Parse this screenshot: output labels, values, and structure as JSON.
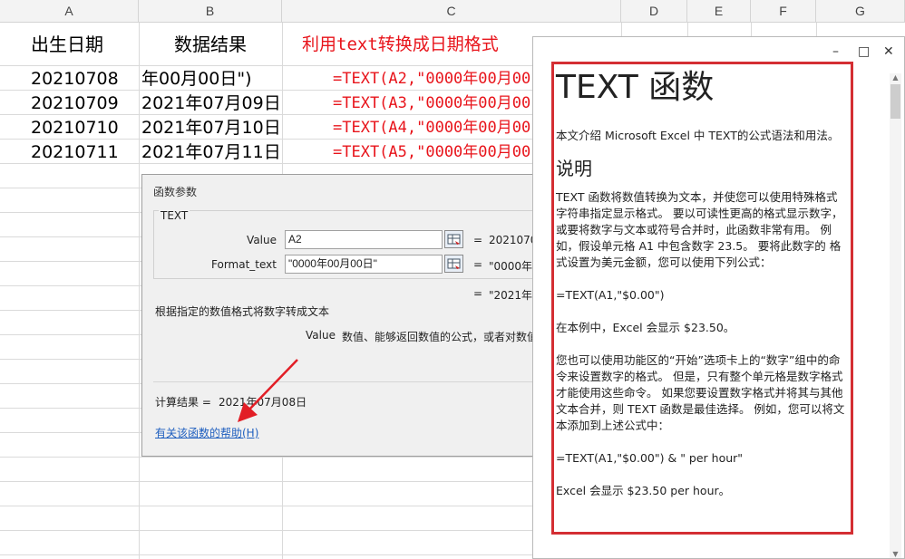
{
  "columns": [
    "A",
    "B",
    "C",
    "D",
    "E",
    "F",
    "G"
  ],
  "headers": {
    "a": "出生日期",
    "b": "数据结果",
    "c": "利用text转换成日期格式"
  },
  "rows": [
    {
      "a": "20210708",
      "b": "年00月00日\")",
      "c": "=TEXT(A2,\"0000年00月00"
    },
    {
      "a": "20210709",
      "b": "2021年07月09日",
      "c": "=TEXT(A3,\"0000年00月00"
    },
    {
      "a": "20210710",
      "b": "2021年07月10日",
      "c": "=TEXT(A4,\"0000年00月00"
    },
    {
      "a": "20210711",
      "b": "2021年07月11日",
      "c": "=TEXT(A5,\"0000年00月00"
    }
  ],
  "dialog": {
    "title": "函数参数",
    "func_name": "TEXT",
    "value_label": "Value",
    "value_input": "A2",
    "value_result": "2021070",
    "format_label": "Format_text",
    "format_input": "\"0000年00月00日\"",
    "format_result": "\"0000年0",
    "eq": "=",
    "overall_result": "\"2021年0",
    "description": "根据指定的数值格式将数字转成文本",
    "arg_name": "Value",
    "arg_desc": "数值、能够返回数值的公式，或者对数值",
    "calc_label": "计算结果 =",
    "calc_value": "2021年07月08日",
    "help_link": "有关该函数的帮助(H)"
  },
  "help": {
    "minimize": "–",
    "maximize": "□",
    "close": "✕",
    "title": "TEXT 函数",
    "intro": "本文介绍 Microsoft Excel 中 TEXT的公式语法和用法。",
    "section": "说明",
    "p1": "TEXT 函数将数值转换为文本，并使您可以使用特殊格式字符串指定显示格式。 要以可读性更高的格式显示数字，或要将数字与文本或符号合并时，此函数非常有用。 例如，假设单元格 A1 中包含数字 23.5。 要将此数字的 格式设置为美元金额，您可以使用下列公式：",
    "f1": "=TEXT(A1,\"$0.00\")",
    "p2": "在本例中，Excel 会显示 $23.50。",
    "p3": "您也可以使用功能区的“开始”选项卡上的“数字”组中的命令来设置数字的格式。 但是，只有整个单元格是数字格式才能使用这些命令。 如果您要设置数字格式并将其与其他文本合并，则 TEXT 函数是最佳选择。 例如，您可以将文本添加到上述公式中：",
    "f2": "=TEXT(A1,\"$0.00\") & \" per hour\"",
    "p4": "Excel 会显示 $23.50 per hour。"
  },
  "colors": {
    "formula": "#e8141b",
    "highlight_box": "#d42e33",
    "link": "#1f5fbf"
  }
}
